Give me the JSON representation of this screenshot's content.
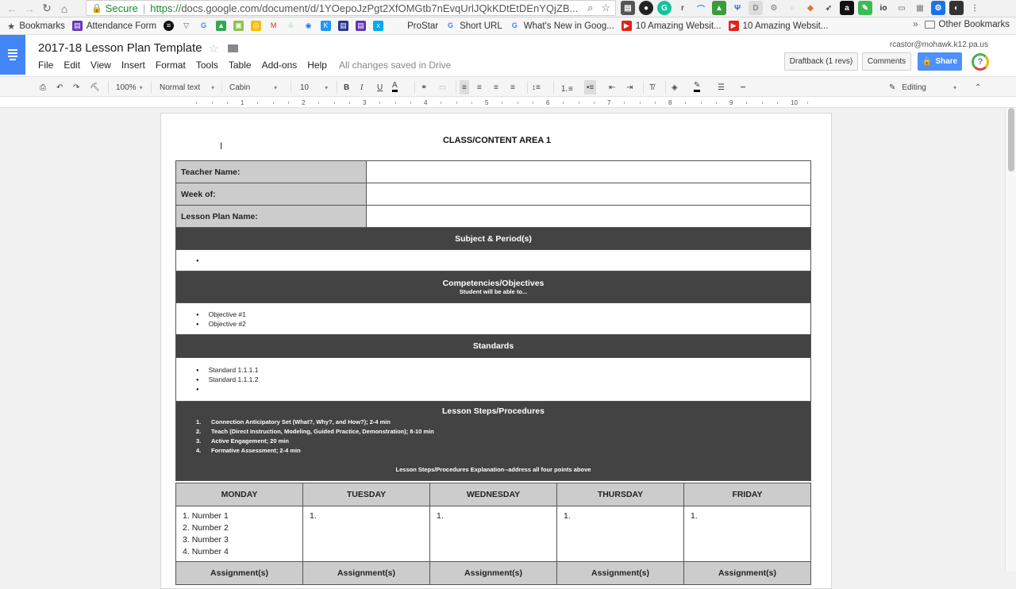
{
  "browser": {
    "secure_label": "Secure",
    "url_proto": "https://",
    "url_rest": "docs.google.com/document/d/1YOepoJzPgt2XfOMGtb7nEvqUrlJQkKDtEtDEnYQjZB..."
  },
  "bookmarks": {
    "items": [
      "Bookmarks",
      "Attendance Form",
      "ProStar",
      "Short URL",
      "What's New in Goog...",
      "10 Amazing Websit...",
      "10 Amazing Websit..."
    ],
    "other": "Other Bookmarks"
  },
  "docs": {
    "title": "2017-18 Lesson Plan Template",
    "menu": [
      "File",
      "Edit",
      "View",
      "Insert",
      "Format",
      "Tools",
      "Table",
      "Add-ons",
      "Help"
    ],
    "saved_status": "All changes saved in Drive",
    "account": "rcastor@mohawk.k12.pa.us",
    "draftback": "Draftback (1 revs)",
    "comments": "Comments",
    "share": "Share"
  },
  "toolbar": {
    "zoom": "100%",
    "style": "Normal text",
    "font": "Cabin",
    "size": "10",
    "bold": "B",
    "italic": "I",
    "underline": "U",
    "text_color": "A",
    "mode": "Editing"
  },
  "ruler": [
    "1",
    "2",
    "3",
    "4",
    "5",
    "6",
    "7",
    "8",
    "9",
    "10"
  ],
  "document": {
    "heading": "CLASS/CONTENT AREA 1",
    "teacher_label": "Teacher Name:",
    "week_label": "Week of:",
    "lesson_label": "Lesson Plan Name:",
    "subject_header": "Subject & Period(s)",
    "competencies_header": "Competencies/Objectives",
    "competencies_sub": "Student will be able to...",
    "objectives": [
      "Objective #1",
      "Objective #2"
    ],
    "standards_header": "Standards",
    "standards": [
      "Standard 1.1.1.1",
      "Standard 1.1.1.2"
    ],
    "steps_header": "Lesson Steps/Procedures",
    "steps": [
      "Connection Anticipatory Set (What?, Why?, and How?); 2-4 min",
      "Teach (Direct Instruction, Modeling, Guided Practice, Demonstration); 8-10 min",
      "Active Engagement; 20 min",
      "Formative Assessment; 2-4 min"
    ],
    "steps_explanation": "Lesson Steps/Procedures Explanation--address all four points above",
    "days": [
      "MONDAY",
      "TUESDAY",
      "WEDNESDAY",
      "THURSDAY",
      "FRIDAY"
    ],
    "monday_items": [
      "Number 1",
      "Number 2",
      "Number 3",
      "Number 4"
    ],
    "other_day_first": "1.",
    "assignments_label": "Assignment(s)"
  },
  "colors": {
    "docs_blue": "#4285f4",
    "dark_header": "#434343",
    "label_gray": "#cccccc",
    "share_blue": "#4d90fe"
  }
}
